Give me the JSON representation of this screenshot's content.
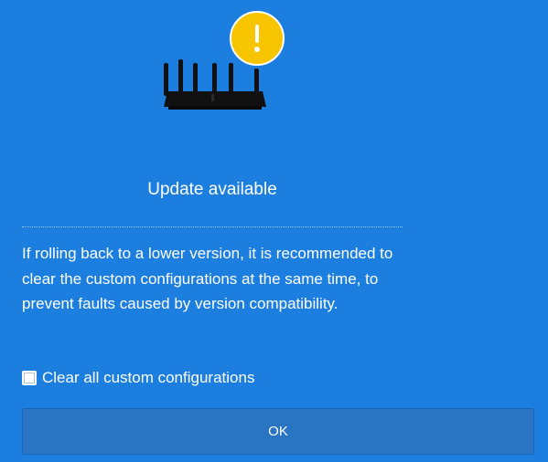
{
  "colors": {
    "background": "#1c7fe0",
    "button_fill": "#2a74c4",
    "warning": "#f7c500",
    "router": "#111111"
  },
  "illustration": {
    "device_icon": "router-icon",
    "status_icon": "warning-icon"
  },
  "dialog": {
    "title": "Update available",
    "message": "If rolling back to a lower version, it is recommended to clear the custom configurations at the same time, to prevent faults caused by version compatibility.",
    "checkbox": {
      "label": "Clear all custom configurations",
      "checked": false
    },
    "ok_label": "OK"
  }
}
